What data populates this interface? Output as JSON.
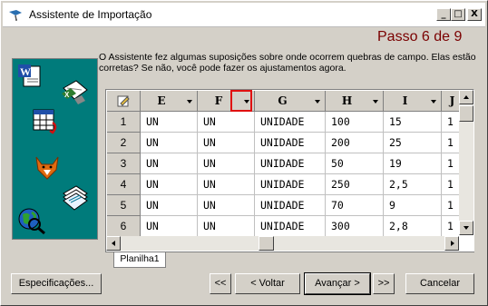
{
  "window": {
    "title": "Assistente de Importação",
    "controls": {
      "minimize": "_",
      "maximize": "□",
      "close": "X"
    }
  },
  "step_label": "Passo 6 de 9",
  "description": "O Assistente fez algumas suposições sobre onde ocorrem quebras de campo. Elas estão corretas? Se não, você pode fazer os ajustamentos agora.",
  "grid": {
    "columns": [
      "E",
      "F",
      "G",
      "H",
      "I",
      "J"
    ],
    "rows": [
      {
        "num": "1",
        "cells": [
          "UN",
          "UN",
          "UNIDADE",
          "100",
          "15",
          "1"
        ]
      },
      {
        "num": "2",
        "cells": [
          "UN",
          "UN",
          "UNIDADE",
          "200",
          "25",
          "1"
        ]
      },
      {
        "num": "3",
        "cells": [
          "UN",
          "UN",
          "UNIDADE",
          "50",
          "19",
          "1"
        ]
      },
      {
        "num": "4",
        "cells": [
          "UN",
          "UN",
          "UNIDADE",
          "250",
          "2,5",
          "1"
        ]
      },
      {
        "num": "5",
        "cells": [
          "UN",
          "UN",
          "UNIDADE",
          "70",
          "9",
          "1"
        ]
      },
      {
        "num": "6",
        "cells": [
          "UN",
          "UN",
          "UNIDADE",
          "300",
          "2,8",
          "1"
        ]
      }
    ]
  },
  "sheet_tab": "Planilha1",
  "buttons": {
    "specs": "Especificações...",
    "first": "<<",
    "back": "< Voltar",
    "next": "Avançar >",
    "last": ">>",
    "cancel": "Cancelar"
  }
}
